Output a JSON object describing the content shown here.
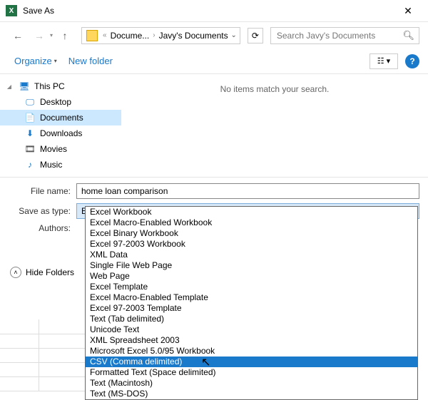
{
  "title": "Save As",
  "nav": {
    "back_enabled": true,
    "crumb1": "Docume...",
    "crumb2": "Javy's Documents",
    "search_placeholder": "Search Javy's Documents"
  },
  "toolbar": {
    "organize": "Organize",
    "new_folder": "New folder"
  },
  "sidebar": {
    "this_pc": "This PC",
    "desktop": "Desktop",
    "documents": "Documents",
    "downloads": "Downloads",
    "movies": "Movies",
    "music": "Music"
  },
  "content": {
    "empty": "No items match your search."
  },
  "form": {
    "filename_label": "File name:",
    "filename_value": "home loan comparison",
    "type_label": "Save as type:",
    "type_value": "Excel 97-2003 Workbook",
    "authors_label": "Authors:"
  },
  "hide_folders": "Hide Folders",
  "dropdown": [
    "Excel Workbook",
    "Excel Macro-Enabled Workbook",
    "Excel Binary Workbook",
    "Excel 97-2003 Workbook",
    "XML Data",
    "Single File Web Page",
    "Web Page",
    "Excel Template",
    "Excel Macro-Enabled Template",
    "Excel 97-2003 Template",
    "Text (Tab delimited)",
    "Unicode Text",
    "XML Spreadsheet 2003",
    "Microsoft Excel 5.0/95 Workbook",
    "CSV (Comma delimited)",
    "Formatted Text (Space delimited)",
    "Text (Macintosh)",
    "Text (MS-DOS)"
  ],
  "dropdown_highlight": 14
}
